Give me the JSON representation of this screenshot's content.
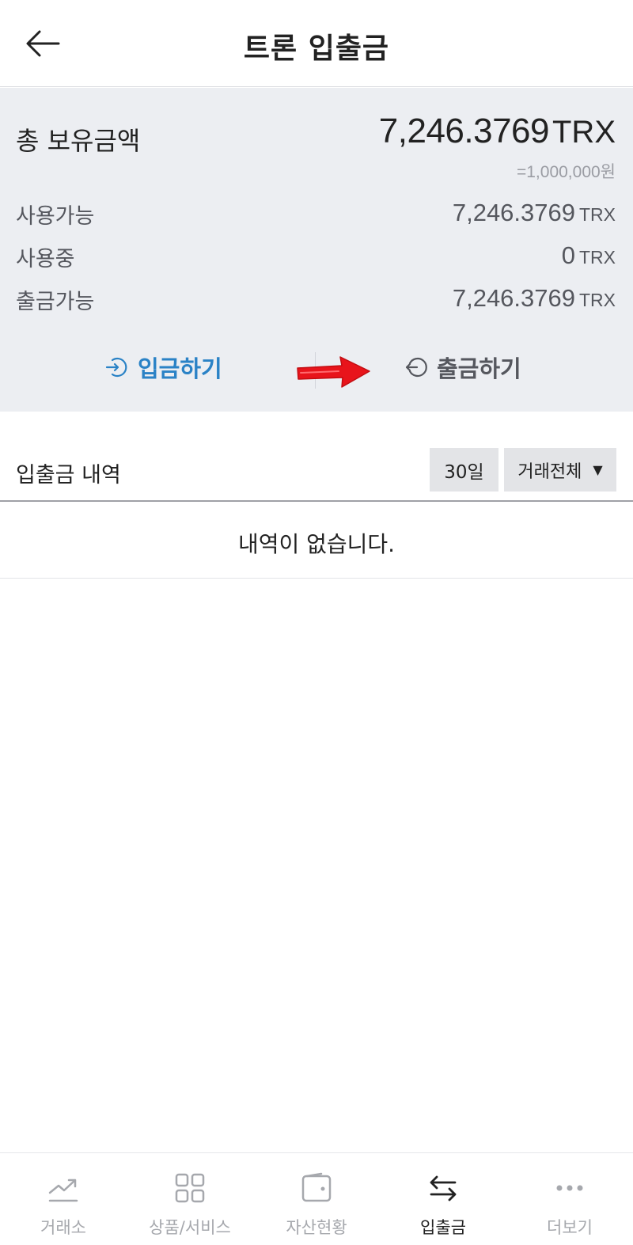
{
  "header": {
    "title": "트론 입출금"
  },
  "summary": {
    "total_label": "총 보유금액",
    "total_amount": "7,246.3769",
    "total_unit": "TRX",
    "krw_value": "=1,000,000원",
    "rows": [
      {
        "label": "사용가능",
        "value": "7,246.3769",
        "unit": "TRX"
      },
      {
        "label": "사용중",
        "value": "0",
        "unit": "TRX"
      },
      {
        "label": "출금가능",
        "value": "7,246.3769",
        "unit": "TRX"
      }
    ],
    "deposit_label": "입금하기",
    "withdraw_label": "출금하기"
  },
  "history": {
    "title": "입출금 내역",
    "period_filter": "30일",
    "type_filter": "거래전체",
    "empty_message": "내역이 없습니다."
  },
  "bottom_nav": {
    "items": [
      {
        "label": "거래소",
        "icon": "chart-trend-icon",
        "active": false
      },
      {
        "label": "상품/서비스",
        "icon": "grid-icon",
        "active": false
      },
      {
        "label": "자산현황",
        "icon": "wallet-icon",
        "active": false
      },
      {
        "label": "입출금",
        "icon": "transfer-arrows-icon",
        "active": true
      },
      {
        "label": "더보기",
        "icon": "more-dots-icon",
        "active": false
      }
    ]
  },
  "colors": {
    "accent_blue": "#2a82c6",
    "panel_bg": "#eceef2",
    "annotation_red": "#e8141b"
  }
}
